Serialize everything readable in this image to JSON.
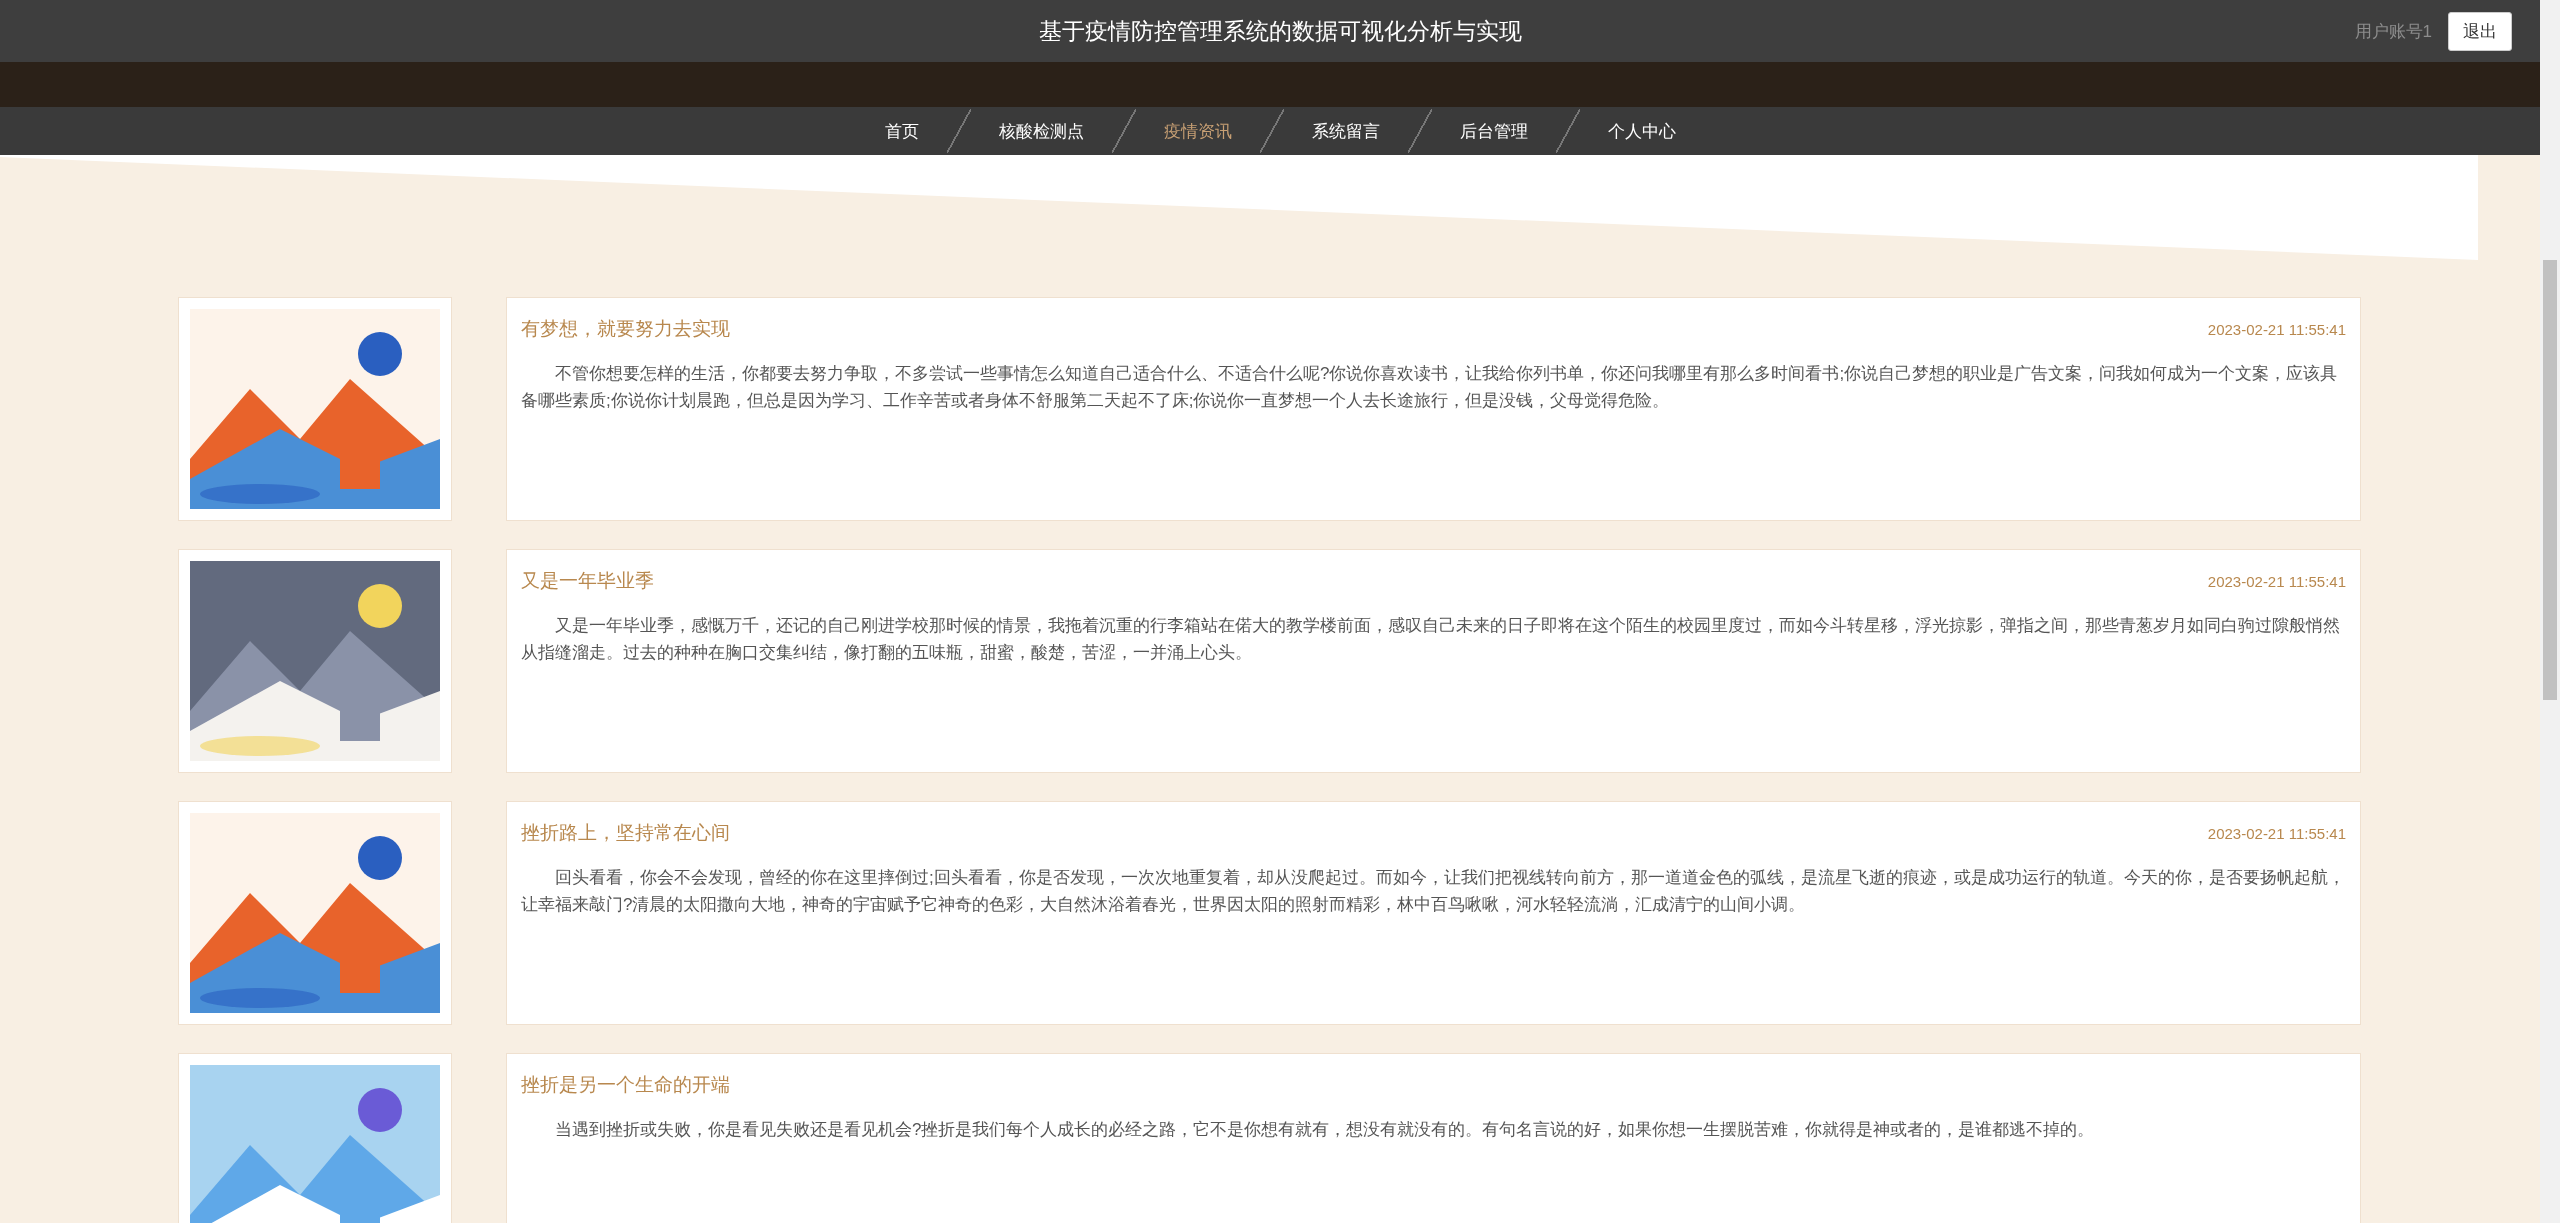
{
  "header": {
    "title": "基于疫情防控管理系统的数据可视化分析与实现",
    "user": "用户账号1",
    "logout": "退出"
  },
  "nav": [
    {
      "label": "首页",
      "selected": false
    },
    {
      "label": "核酸检测点",
      "selected": false
    },
    {
      "label": "疫情资讯",
      "selected": true
    },
    {
      "label": "系统留言",
      "selected": false
    },
    {
      "label": "后台管理",
      "selected": false
    },
    {
      "label": "个人中心",
      "selected": false
    }
  ],
  "news": [
    {
      "kind": "picture",
      "title": "有梦想，就要努力去实现",
      "date": "2023-02-21 11:55:41",
      "body": "不管你想要怎样的生活，你都要去努力争取，不多尝试一些事情怎么知道自己适合什么、不适合什么呢?你说你喜欢读书，让我给你列书单，你还问我哪里有那么多时间看书;你说自己梦想的职业是广告文案，问我如何成为一个文案，应该具备哪些素质;你说你计划晨跑，但总是因为学习、工作辛苦或者身体不舒服第二天起不了床;你说你一直梦想一个人去长途旅行，但是没钱，父母觉得危险。"
    },
    {
      "kind": "picture",
      "title": "又是一年毕业季",
      "date": "2023-02-21 11:55:41",
      "body": "又是一年毕业季，感慨万千，还记的自己刚进学校那时候的情景，我拖着沉重的行李箱站在偌大的教学楼前面，感叹自己未来的日子即将在这个陌生的校园里度过，而如今斗转星移，浮光掠影，弹指之间，那些青葱岁月如同白驹过隙般悄然从指缝溜走。过去的种种在胸口交集纠结，像打翻的五味瓶，甜蜜，酸楚，苦涩，一并涌上心头。"
    },
    {
      "kind": "picture",
      "title": "挫折路上，坚持常在心间",
      "date": "2023-02-21 11:55:41",
      "body": "回头看看，你会不会发现，曾经的你在这里摔倒过;回头看看，你是否发现，一次次地重复着，却从没爬起过。而如今，让我们把视线转向前方，那一道道金色的弧线，是流星飞逝的痕迹，或是成功运行的轨道。今天的你，是否要扬帆起航，让幸福来敲门?清晨的太阳撒向大地，神奇的宇宙赋予它神奇的色彩，大自然沐浴着春光，世界因太阳的照射而精彩，林中百鸟啾啾，河水轻轻流淌，汇成清宁的山间小调。"
    },
    {
      "kind": "picture",
      "title": "挫折是另一个生命的开端",
      "body": "当遇到挫折或失败，你是看见失败还是看见机会?挫折是我们每个人成长的必经之路，它不是你想有就有，想没有就没有的。有句名言说的好，如果你想一生摆脱苦难，你就得是神或者的，是谁都逃不掉的。"
    }
  ]
}
